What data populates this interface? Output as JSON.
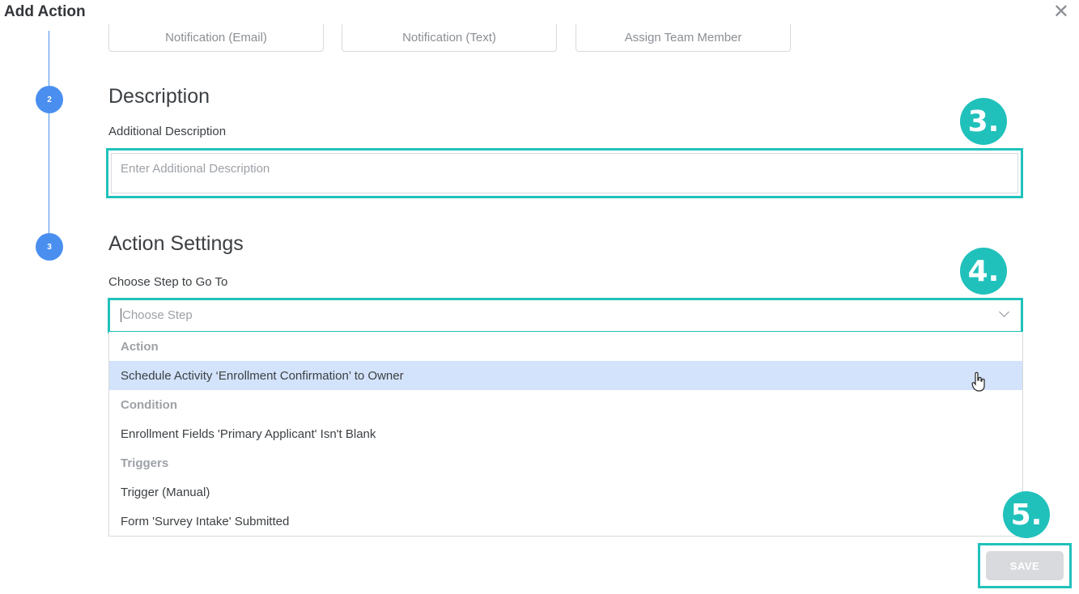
{
  "modal": {
    "title": "Add Action",
    "close_icon": "close-icon"
  },
  "type_buttons": [
    "Notification (Email)",
    "Notification (Text)",
    "Assign Team Member"
  ],
  "steps": [
    "2",
    "3"
  ],
  "description_section": {
    "title": "Description",
    "label": "Additional Description",
    "placeholder": "Enter Additional Description"
  },
  "settings_section": {
    "title": "Action Settings",
    "label": "Choose Step to Go To",
    "placeholder": "Choose Step"
  },
  "dropdown": {
    "groups": [
      "Action",
      "Condition",
      "Triggers"
    ],
    "items": [
      "Schedule Activity ‘Enrollment Confirmation’ to Owner",
      "Enrollment Fields 'Primary Applicant' Isn't Blank",
      "Trigger (Manual)",
      "Form 'Survey Intake' Submitted"
    ],
    "highlighted_item": "Schedule Activity ‘Enrollment Confirmation’ to Owner"
  },
  "annotations": [
    "3.",
    "4.",
    "5."
  ],
  "save_label": "SAVE",
  "colors": {
    "accent_teal": "#21c1bb",
    "step_blue": "#4a8ff0",
    "highlight": "#d3e3fb"
  }
}
